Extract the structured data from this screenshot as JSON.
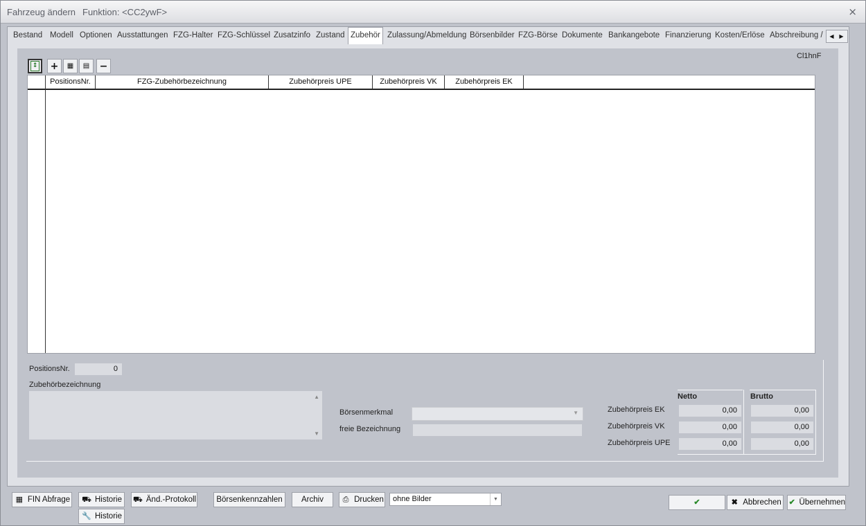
{
  "window": {
    "title": "Fahrzeug ändern",
    "function": "Funktion: <CC2ywF>",
    "close": "×"
  },
  "tabs": [
    "Bestand",
    "Modell",
    "Optionen",
    "Ausstattungen",
    "FZG-Halter",
    "FZG-Schlüssel",
    "Zusatzinfo",
    "Zustand",
    "Zubehör",
    "Zulassung/Abmeldung",
    "Börsenbilder",
    "FZG-Börse",
    "Dokumente",
    "Bankangebote",
    "Finanzierung",
    "Kosten/Erlöse",
    "Abschreibung / \\"
  ],
  "active_tab": "Zubehör",
  "record_id": "Cl1hnF",
  "grid": {
    "columns": [
      "PositionsNr.",
      "FZG-Zubehörbezeichnung",
      "Zubehörpreis UPE",
      "Zubehörpreis VK",
      "Zubehörpreis EK"
    ],
    "rows": []
  },
  "detail": {
    "positions_label": "PositionsNr.",
    "positions_value": "0",
    "bezeichnung_label": "Zubehörbezeichnung",
    "boersenmerkmal_label": "Börsenmerkmal",
    "freie_label": "freie Bezeichnung",
    "netto_header": "Netto",
    "brutto_header": "Brutto",
    "prices": [
      {
        "label": "Zubehörpreis EK",
        "netto": "0,00",
        "brutto": "0,00"
      },
      {
        "label": "Zubehörpreis VK",
        "netto": "0,00",
        "brutto": "0,00"
      },
      {
        "label": "Zubehörpreis UPE",
        "netto": "0,00",
        "brutto": "0,00"
      }
    ]
  },
  "footer": {
    "fin": "FIN Abfrage",
    "historie": "Historie",
    "aend": "Änd.-Protokoll",
    "historie2": "Historie",
    "boersenkennzahlen": "Börsenkennzahlen",
    "archiv": "Archiv",
    "drucken": "Drucken",
    "bilder_select": "ohne Bilder",
    "ok": "OK",
    "abbrechen": "Abbrechen",
    "uebernehmen": "Übernehmen"
  }
}
